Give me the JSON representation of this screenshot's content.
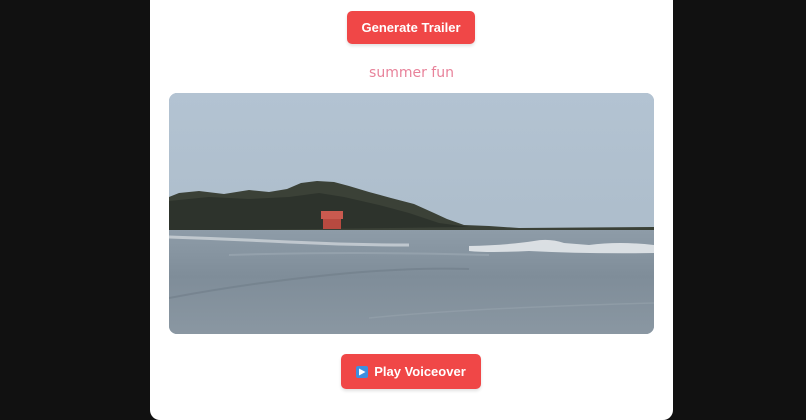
{
  "actions": {
    "generate_label": "Generate Trailer",
    "voiceover_label": "Play Voiceover"
  },
  "clip": {
    "caption": "summer fun"
  },
  "icons": {
    "voiceover_icon": "play-icon"
  },
  "colors": {
    "accent": "#f04747",
    "caption": "#e8829a",
    "background": "#111111",
    "card": "#ffffff"
  }
}
